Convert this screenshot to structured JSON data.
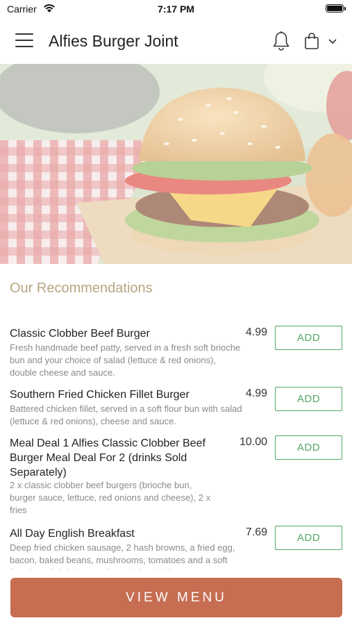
{
  "status_bar": {
    "carrier": "Carrier",
    "time": "7:17 PM"
  },
  "header": {
    "title": "Alfies Burger Joint"
  },
  "recommendations": {
    "title": "Our Recommendations",
    "items": [
      {
        "name": "Classic Clobber Beef Burger",
        "desc": "Fresh handmade beef patty, served in a fresh soft brioche bun and your choice of salad (lettuce & red onions), double cheese and sauce.",
        "price": "4.99",
        "add_label": "ADD"
      },
      {
        "name": "Southern Fried Chicken Fillet Burger",
        "desc": "Battered chicken fillet, served in a soft flour bun with salad (lettuce & red onions), cheese and sauce.",
        "price": "4.99",
        "add_label": "ADD"
      },
      {
        "name": "Meal Deal 1 Alfies Classic Clobber Beef Burger Meal Deal For 2 (drinks Sold Separately)",
        "desc": "2 x classic clobber beef burgers (brioche bun, burger sauce, lettuce, red onions and cheese), 2 x fries",
        "price": "10.00",
        "add_label": "ADD"
      },
      {
        "name": "All Day English Breakfast",
        "desc": "Deep fried chicken sausage, 2 hash browns, a fried egg, bacon, baked beans, mushrooms, tomatoes and a soft flour bun (lightly buttered). Includes drink",
        "price": "7.69",
        "add_label": "ADD"
      }
    ]
  },
  "footer": {
    "view_menu_label": "VIEW MENU"
  },
  "colors": {
    "accent": "#c66d52",
    "add_green": "#52a867",
    "section_title": "#b8a582"
  },
  "icons": [
    "menu-icon",
    "bell-icon",
    "shopping-bag-icon",
    "chevron-down-icon",
    "wifi-icon",
    "battery-icon"
  ]
}
